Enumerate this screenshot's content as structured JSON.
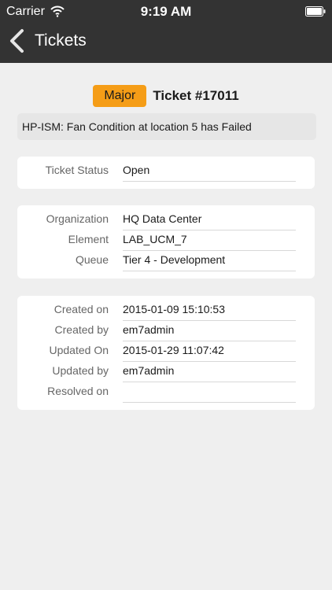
{
  "status_bar": {
    "carrier": "Carrier",
    "time": "9:19 AM"
  },
  "nav": {
    "title": "Tickets"
  },
  "ticket": {
    "severity": "Major",
    "title": "Ticket #17011",
    "message": "HP-ISM: Fan Condition at location 5 has Failed",
    "severity_color": "#f59d17"
  },
  "status_card": {
    "fields": [
      {
        "label": "Ticket Status",
        "value": "Open"
      }
    ]
  },
  "org_card": {
    "fields": [
      {
        "label": "Organization",
        "value": "HQ Data Center"
      },
      {
        "label": "Element",
        "value": "LAB_UCM_7"
      },
      {
        "label": "Queue",
        "value": "Tier 4 - Development"
      }
    ]
  },
  "dates_card": {
    "fields": [
      {
        "label": "Created on",
        "value": "2015-01-09 15:10:53"
      },
      {
        "label": "Created by",
        "value": "em7admin"
      },
      {
        "label": "Updated On",
        "value": "2015-01-29 11:07:42"
      },
      {
        "label": "Updated by",
        "value": "em7admin"
      },
      {
        "label": "Resolved on",
        "value": ""
      }
    ]
  },
  "colors": {
    "nav_background": "#333333",
    "page_background": "#efefef"
  }
}
